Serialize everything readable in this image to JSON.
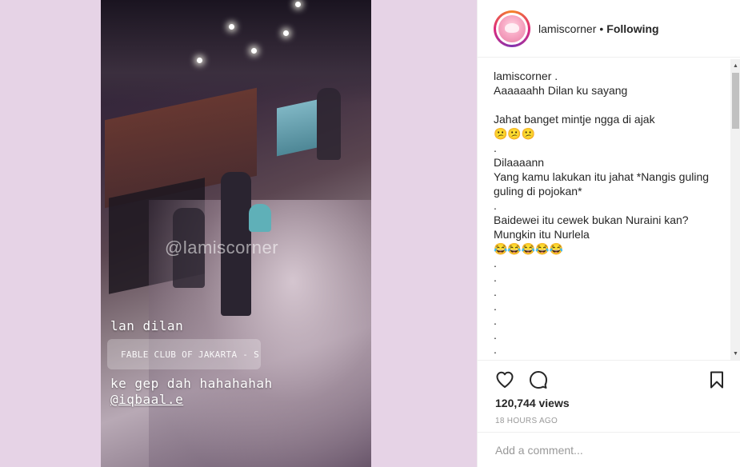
{
  "story": {
    "watermark": "@lamiscorner",
    "line1": "lan dilan",
    "location_label": "FABLE CLUB OF JAKARTA - S...",
    "line2": "ke gep dah hahahahah",
    "mention": "@iqbaal.e"
  },
  "header": {
    "username": "lamiscorner",
    "separator": "•",
    "follow_status": "Following"
  },
  "caption": {
    "username": "lamiscorner .",
    "lines": [
      "Aaaaaahh Dilan ku sayang",
      "",
      "Jahat banget mintje ngga di ajak",
      "😕😕😕",
      ".",
      "Dilaaaann",
      "Yang kamu lakukan itu jahat *Nangis guling",
      "guling di pojokan*",
      ".",
      "Baidewei itu cewek bukan Nuraini kan?",
      "Mungkin itu Nurlela",
      "😂😂😂😂😂",
      ".",
      ".",
      ".",
      ".",
      ".",
      ".",
      "."
    ]
  },
  "scrollbar": {
    "up": "▲",
    "down": "▼"
  },
  "actions": {
    "like_icon": "heart-icon",
    "comment_icon": "comment-icon",
    "save_icon": "bookmark-icon"
  },
  "stats": {
    "views": "120,744 views",
    "timestamp": "18 HOURS AGO"
  },
  "comment": {
    "placeholder": "Add a comment..."
  },
  "colors": {
    "background": "#e6d3e6",
    "text": "#262626",
    "muted": "#999999"
  }
}
